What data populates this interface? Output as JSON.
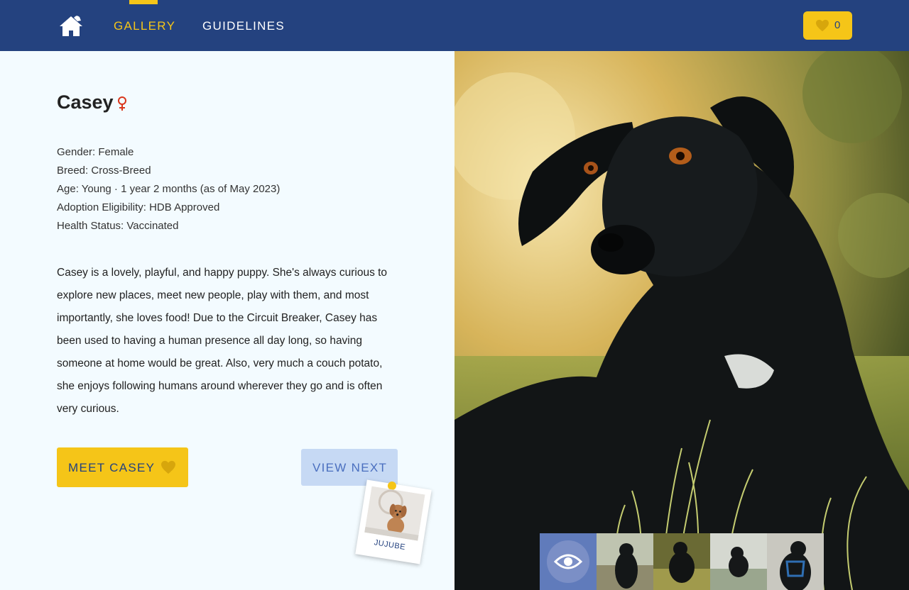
{
  "nav": {
    "links": [
      {
        "label": "GALLERY",
        "active": true
      },
      {
        "label": "GUIDELINES",
        "active": false
      }
    ],
    "favorites_count": "0",
    "logo_icon": "dog-house-icon",
    "fav_icon": "heart-icon"
  },
  "dog": {
    "name": "Casey",
    "gender_icon": "female-symbol-icon",
    "facts": [
      "Gender: Female",
      "Breed: Cross-Breed",
      "Age: Young · 1 year 2 months (as of May 2023)",
      "Adoption Eligibility: HDB Approved",
      "Health Status: Vaccinated"
    ],
    "description": "Casey is a lovely, playful, and happy puppy. She's always curious to explore new places, meet new people, play with them, and most importantly, she loves food! Due to the Circuit Breaker, Casey has been used to having a human presence all day long, so having someone at home would be great. Also, very much a couch potato, she enjoys following humans around wherever they go and is often very curious."
  },
  "actions": {
    "meet_label": "MEET CASEY",
    "next_label": "VIEW NEXT"
  },
  "next_dog": {
    "name": "JUJUBE"
  },
  "gallery": {
    "thumbnail_count": 5,
    "active_index": 0,
    "active_icon": "eye-icon"
  },
  "colors": {
    "navy": "#24427f",
    "yellow": "#f5c518",
    "light_blue": "#c6d9f4",
    "background": "#f3fbff",
    "female": "#d9361c"
  }
}
